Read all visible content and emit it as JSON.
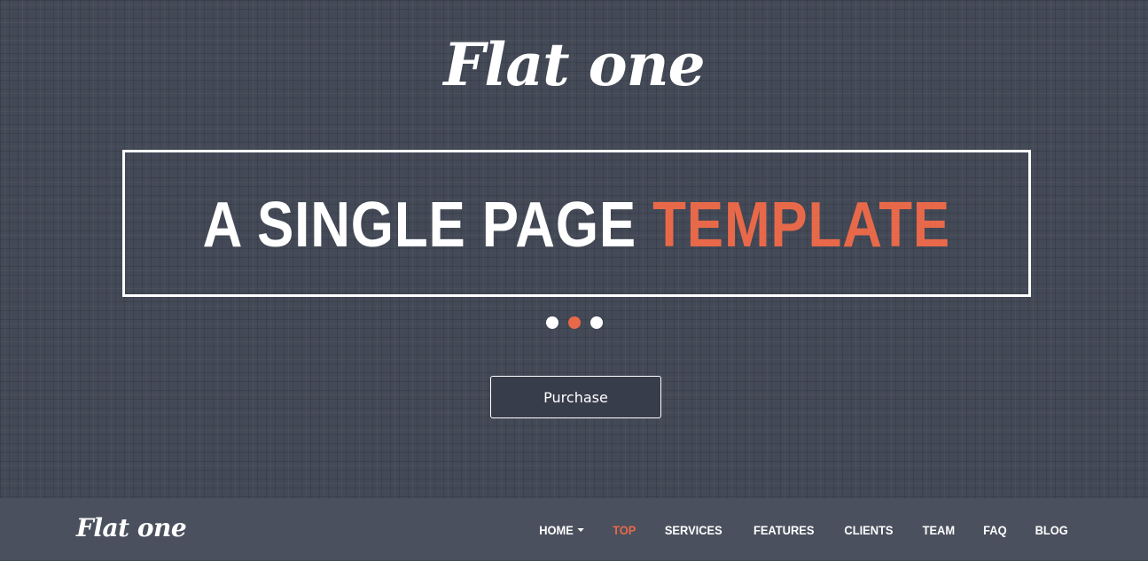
{
  "hero": {
    "logo_text": "Flat one",
    "headline_main": "A SINGLE PAGE ",
    "headline_accent": "TEMPLATE",
    "slider_dots": 3,
    "active_dot": 2,
    "purchase_label": "Purchase"
  },
  "navbar": {
    "logo_text": "Flat one",
    "items": [
      {
        "label": "HOME",
        "dropdown": true
      },
      {
        "label": "TOP",
        "active": true
      },
      {
        "label": "SERVICES"
      },
      {
        "label": "FEATURES"
      },
      {
        "label": "CLIENTS"
      },
      {
        "label": "TEAM"
      },
      {
        "label": "FAQ"
      },
      {
        "label": "BLOG"
      }
    ]
  },
  "colors": {
    "background": "#434956",
    "navbar": "#4a505d",
    "accent": "#e8694a",
    "button": "#383d4b",
    "text": "#ffffff"
  },
  "icons": {
    "dropdown": "caret-down-icon"
  }
}
